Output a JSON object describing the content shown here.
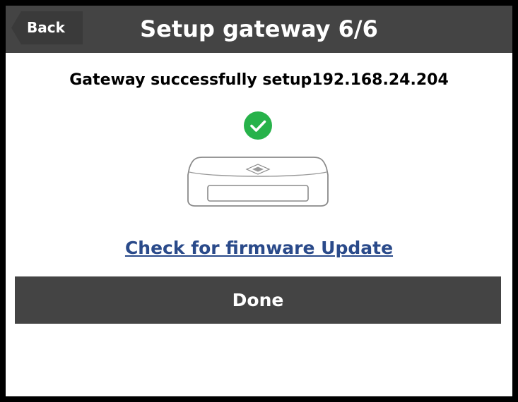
{
  "header": {
    "back_label": "Back",
    "title": "Setup gateway 6/6",
    "background_color": "#444444"
  },
  "main": {
    "status_message": "Gateway successfully setup192.168.24.204",
    "status_icon": "check-circle-icon",
    "status_icon_color": "#27b24a",
    "illustration": "gateway-device",
    "firmware_link_label": "Check for firmware Update",
    "link_color": "#2a4a8a"
  },
  "footer": {
    "done_label": "Done",
    "button_color": "#444444"
  }
}
